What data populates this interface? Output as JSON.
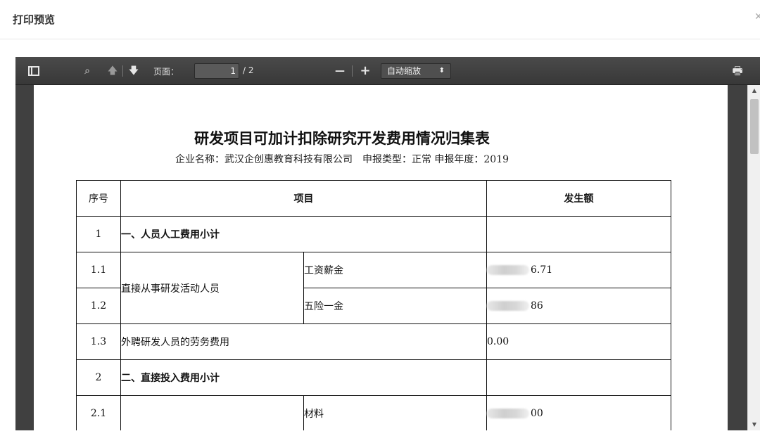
{
  "modal": {
    "title": "打印预览",
    "close_icon": "close-icon"
  },
  "toolbar": {
    "sidebar_toggle_icon": "sidebar-toggle-icon",
    "search_icon": "search-icon",
    "prev_icon": "arrow-up-icon",
    "next_icon": "arrow-down-icon",
    "page_label": "页面：",
    "page_current": "1",
    "page_total": "/ 2",
    "zoom_out": "—",
    "zoom_in": "+",
    "zoom_value": "自动缩放",
    "print_icon": "print-icon"
  },
  "document": {
    "title": "研发项目可加计扣除研究开发费用情况归集表",
    "subtitle": "企业名称：武汉企创惠教育科技有限公司　申报类型：正常 申报年度：2019",
    "headers": {
      "seq": "序号",
      "item": "项目",
      "amount": "发生额"
    },
    "rows": {
      "r1": {
        "seq": "1",
        "item": "一、人员人工费用小计",
        "amount": ""
      },
      "r11": {
        "seq": "1.1",
        "group": "直接从事研发活动人员",
        "sub": "工资薪金",
        "amount": "6.71"
      },
      "r12": {
        "seq": "1.2",
        "sub": "五险一金",
        "amount": "86"
      },
      "r13": {
        "seq": "1.3",
        "item": "外聘研发人员的劳务费用",
        "amount": "0.00"
      },
      "r2": {
        "seq": "2",
        "item": "二、直接投入费用小计",
        "amount": ""
      },
      "r21": {
        "seq": "2.1",
        "group": "",
        "sub": "材料",
        "amount": "00"
      }
    }
  }
}
